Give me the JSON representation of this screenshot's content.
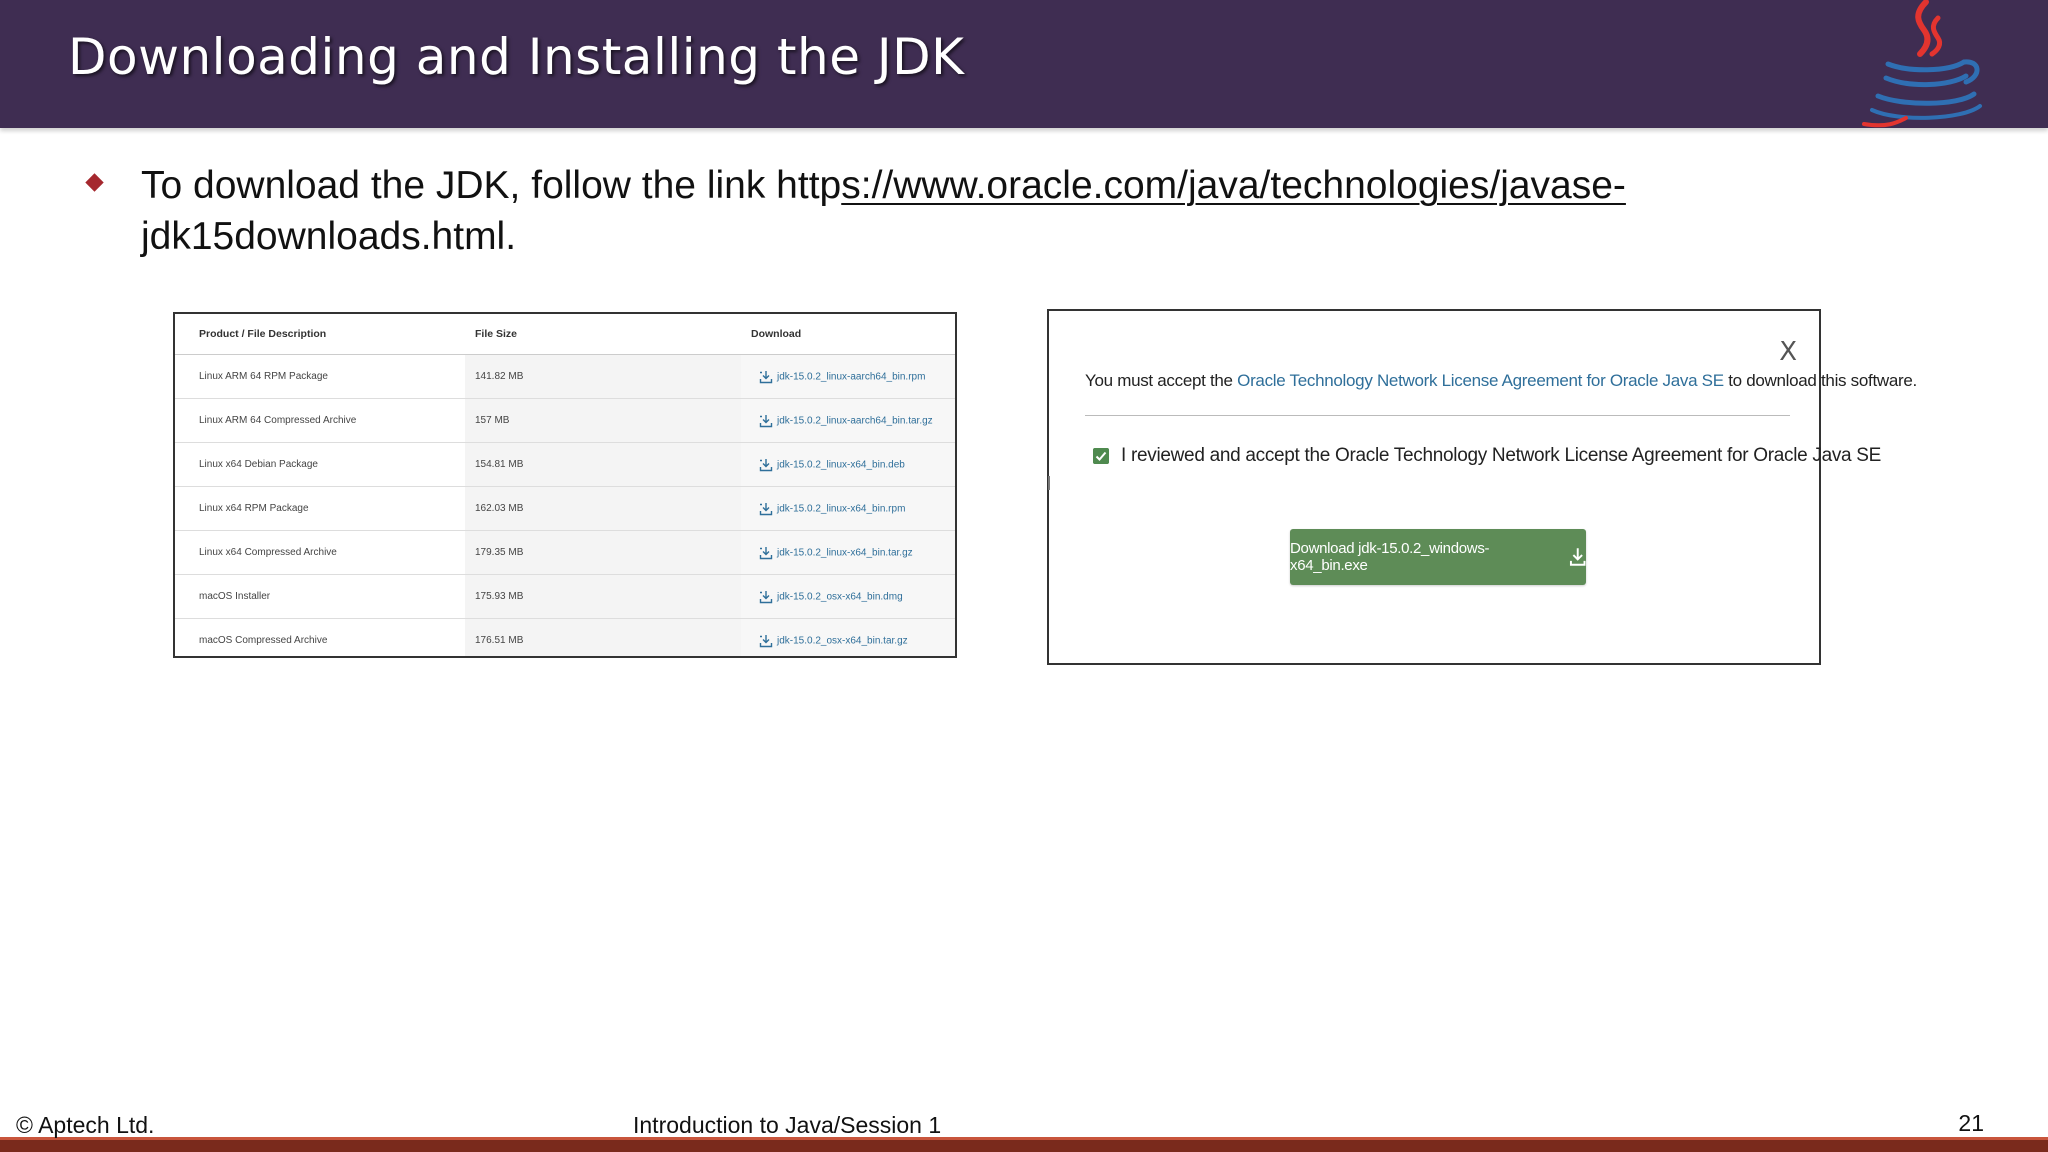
{
  "slide": {
    "title": "Downloading and Installing the JDK",
    "bullet": {
      "text_before": "To download the JDK, follow the link http",
      "link_text": "s://www.oracle.com/java/technologies/javase-",
      "text_after": "jdk15downloads.html."
    },
    "colors": {
      "header_bg": "#3f2d52",
      "bullet": "#a5282e",
      "footer_bar": "#7a2a1c",
      "button": "#5e8c57",
      "link": "#2f6f9a"
    },
    "logo_icon": "java-coffee-cup-logo"
  },
  "downloads_table": {
    "headers": [
      "Product / File Description",
      "File Size",
      "Download"
    ],
    "rows": [
      {
        "description": "Linux ARM 64 RPM Package",
        "size": "141.82 MB",
        "file": "jdk-15.0.2_linux-aarch64_bin.rpm"
      },
      {
        "description": "Linux ARM 64 Compressed Archive",
        "size": "157 MB",
        "file": "jdk-15.0.2_linux-aarch64_bin.tar.gz"
      },
      {
        "description": "Linux x64 Debian Package",
        "size": "154.81 MB",
        "file": "jdk-15.0.2_linux-x64_bin.deb"
      },
      {
        "description": "Linux x64 RPM Package",
        "size": "162.03 MB",
        "file": "jdk-15.0.2_linux-x64_bin.rpm"
      },
      {
        "description": "Linux x64 Compressed Archive",
        "size": "179.35 MB",
        "file": "jdk-15.0.2_linux-x64_bin.tar.gz"
      },
      {
        "description": "macOS Installer",
        "size": "175.93 MB",
        "file": "jdk-15.0.2_osx-x64_bin.dmg"
      },
      {
        "description": "macOS Compressed Archive",
        "size": "176.51 MB",
        "file": "jdk-15.0.2_osx-x64_bin.tar.gz"
      }
    ],
    "download_icon": "download-icon"
  },
  "license_dialog": {
    "close_label": "X",
    "message_prefix": "You must accept the ",
    "message_link": "Oracle Technology Network License Agreement for Oracle Java SE",
    "message_suffix": " to download this software.",
    "checkbox_checked": true,
    "checkbox_label": "I reviewed and accept the Oracle Technology Network License Agreement for Oracle Java SE",
    "button_label": "Download jdk-15.0.2_windows-x64_bin.exe",
    "button_icon": "download-icon"
  },
  "footer": {
    "copyright": "© Aptech Ltd.",
    "course": "Introduction to Java/Session 1",
    "page_number": "21"
  }
}
